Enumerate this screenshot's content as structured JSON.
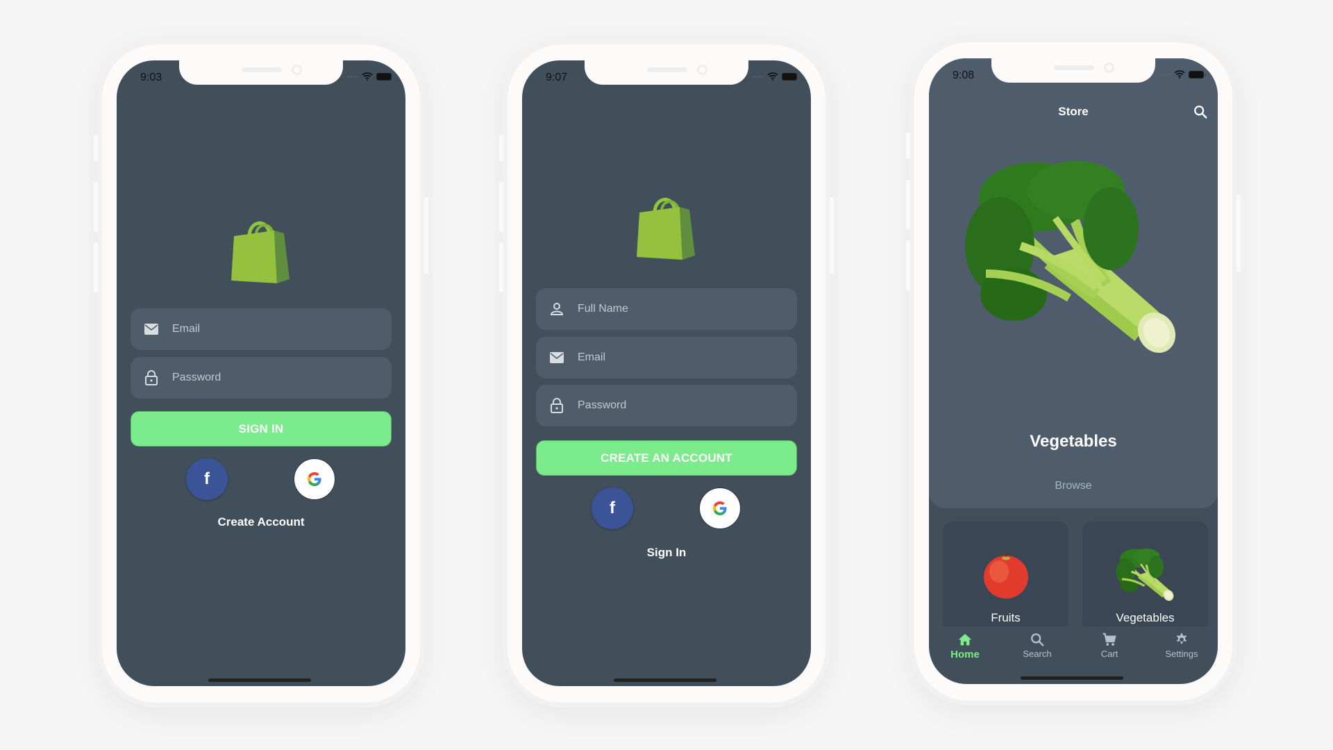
{
  "colors": {
    "background": "#f5f5f5",
    "screen": "#414f5b",
    "field": "#4f5c69",
    "accent_green": "#7beb8c",
    "facebook_blue": "#3b5497",
    "nav_inactive": "#b4c2d0"
  },
  "screens": [
    {
      "name": "sign-in",
      "status": {
        "time": "9:03"
      },
      "logo": "shopping-bag-logo",
      "fields": [
        {
          "icon": "mail-icon",
          "placeholder": "Email",
          "value": ""
        },
        {
          "icon": "lock-icon",
          "placeholder": "Password",
          "value": ""
        }
      ],
      "primary_button": "SIGN IN",
      "social": [
        {
          "icon": "facebook-icon",
          "glyph": "f"
        },
        {
          "icon": "google-icon",
          "glyph": "G"
        }
      ],
      "secondary_link": "Create Account"
    },
    {
      "name": "create-account",
      "status": {
        "time": "9:07"
      },
      "logo": "shopping-bag-logo",
      "fields": [
        {
          "icon": "person-icon",
          "placeholder": "Full Name",
          "value": ""
        },
        {
          "icon": "mail-icon",
          "placeholder": "Email",
          "value": ""
        },
        {
          "icon": "lock-icon",
          "placeholder": "Password",
          "value": ""
        }
      ],
      "primary_button": "CREATE AN ACCOUNT",
      "social": [
        {
          "icon": "facebook-icon",
          "glyph": "f"
        },
        {
          "icon": "google-icon",
          "glyph": "G"
        }
      ],
      "secondary_link": "Sign In"
    },
    {
      "name": "store",
      "status": {
        "time": "9:08"
      },
      "header": {
        "title": "Store",
        "action_icon": "search-icon"
      },
      "hero": {
        "image": "broccoli-image",
        "title": "Vegetables",
        "action": "Browse"
      },
      "categories": [
        {
          "label": "Fruits",
          "image": "apple-image"
        },
        {
          "label": "Vegetables",
          "image": "broccoli-image"
        }
      ],
      "bottom_nav": [
        {
          "label": "Home",
          "icon": "home-icon",
          "active": true
        },
        {
          "label": "Search",
          "icon": "search-icon",
          "active": false
        },
        {
          "label": "Cart",
          "icon": "cart-icon",
          "active": false
        },
        {
          "label": "Settings",
          "icon": "gear-icon",
          "active": false
        }
      ]
    }
  ]
}
